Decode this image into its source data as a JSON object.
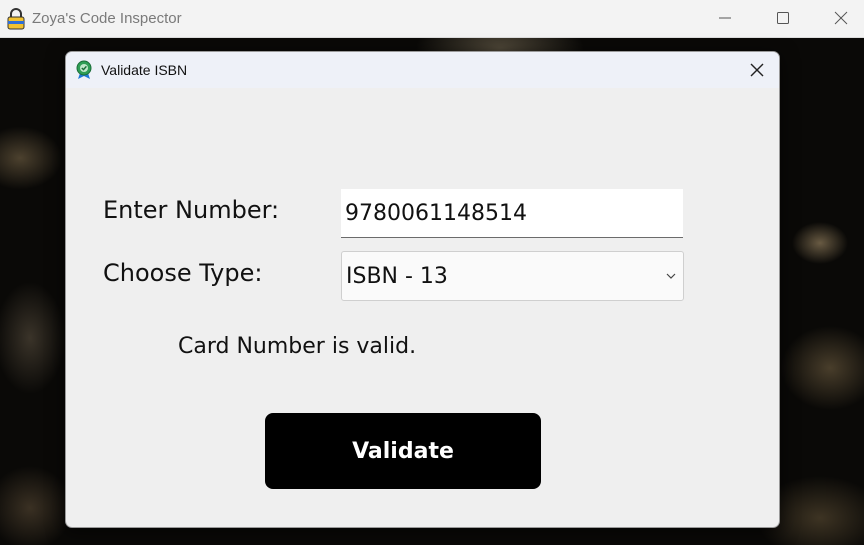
{
  "window": {
    "title": "Zoya's Code Inspector"
  },
  "dialog": {
    "title": "Validate ISBN",
    "number_label": "Enter Number:",
    "number_value": "9780061148514",
    "type_label": "Choose Type:",
    "type_selected": "ISBN - 13",
    "status_message": "Card Number is valid.",
    "validate_label": "Validate"
  },
  "colors": {
    "button_bg": "#000000",
    "dialog_bg": "#efefef",
    "title_bar_bg": "#f3f3f3"
  },
  "icons": {
    "app": "padlock-icon",
    "dialog": "badge-check-icon",
    "minimize": "minimize-icon",
    "maximize": "maximize-icon",
    "close": "close-icon",
    "dropdown": "chevron-down-icon"
  }
}
